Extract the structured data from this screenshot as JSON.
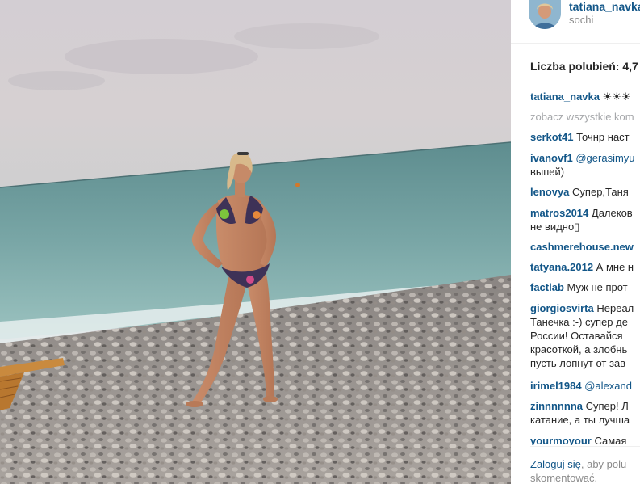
{
  "post": {
    "username": "tatiana_navka",
    "location": "sochi",
    "likes_label": "Liczba polubień: 4,7",
    "caption": {
      "username": "tatiana_navka",
      "text": "☀☀☀"
    },
    "see_all_comments": "zobacz wszystkie kom",
    "comments": [
      {
        "username": "serkot41",
        "text": " Точнр наст"
      },
      {
        "username": "ivanovf1",
        "mention": " @gerasimyu",
        "text": "выпей)"
      },
      {
        "username": "lenovya",
        "text": " Супер,Таня"
      },
      {
        "username": "matros2014",
        "text": " Далеков",
        "text2": "не видно▯"
      },
      {
        "username": "cashmerehouse.new",
        "text": ""
      },
      {
        "username": "tatyana.2012",
        "text": " А мне н"
      },
      {
        "username": "factlab",
        "text": " Муж не прот"
      },
      {
        "username": "giorgiosvirta",
        "text": " Нереал",
        "text2": "Танечка :-) супер де",
        "text3": "России! Оставайся ",
        "text4": "красоткой, а злобнь",
        "text5": "пусть лопнут от зав"
      },
      {
        "username": "irimel1984",
        "mention": " @alexand",
        "text": ""
      },
      {
        "username": "zinnnnnna",
        "text": " Супер! Л",
        "text2": "катание, а ты лучша"
      },
      {
        "username": "yourmoyour",
        "text": " Самая"
      }
    ],
    "login_link": "Zaloguj się",
    "login_text": ", aby polu",
    "login_text2": "skomentować."
  },
  "colors": {
    "link": "#125688",
    "text": "#262626",
    "muted": "#a5a7aa"
  }
}
